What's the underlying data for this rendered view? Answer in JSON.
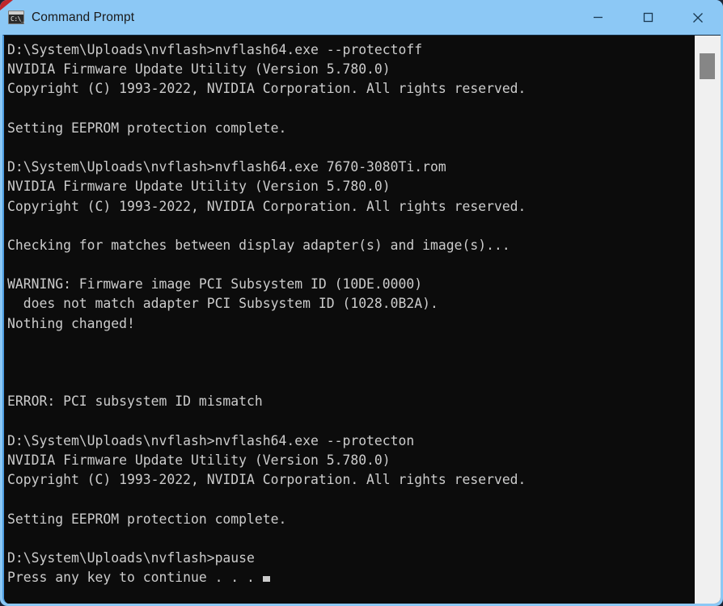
{
  "window": {
    "title": "Command Prompt",
    "icon": "command-prompt-icon",
    "icon_prompt_text": "C:\\_",
    "titlebar_color": "#8cc8f5",
    "corner_marker_color": "#c0272d",
    "controls": [
      {
        "name": "minimize",
        "glyph": "—"
      },
      {
        "name": "maximize",
        "glyph": "□"
      },
      {
        "name": "close",
        "glyph": "✕"
      }
    ]
  },
  "terminal": {
    "background_color": "#0c0c0c",
    "foreground_color": "#cccccc",
    "lines": [
      "D:\\System\\Uploads\\nvflash>nvflash64.exe --protectoff",
      "NVIDIA Firmware Update Utility (Version 5.780.0)",
      "Copyright (C) 1993-2022, NVIDIA Corporation. All rights reserved.",
      "",
      "Setting EEPROM protection complete.",
      "",
      "D:\\System\\Uploads\\nvflash>nvflash64.exe 7670-3080Ti.rom",
      "NVIDIA Firmware Update Utility (Version 5.780.0)",
      "Copyright (C) 1993-2022, NVIDIA Corporation. All rights reserved.",
      "",
      "Checking for matches between display adapter(s) and image(s)...",
      "",
      "WARNING: Firmware image PCI Subsystem ID (10DE.0000)",
      "  does not match adapter PCI Subsystem ID (1028.0B2A).",
      "Nothing changed!",
      "",
      "",
      "",
      "ERROR: PCI subsystem ID mismatch",
      "",
      "D:\\System\\Uploads\\nvflash>nvflash64.exe --protecton",
      "NVIDIA Firmware Update Utility (Version 5.780.0)",
      "Copyright (C) 1993-2022, NVIDIA Corporation. All rights reserved.",
      "",
      "Setting EEPROM protection complete.",
      "",
      "D:\\System\\Uploads\\nvflash>pause"
    ],
    "prompt_line": "Press any key to continue . . .",
    "cursor": "block-cursor"
  },
  "scrollbar": {
    "track_color": "#f0f0f0",
    "thumb_color": "#868686"
  }
}
